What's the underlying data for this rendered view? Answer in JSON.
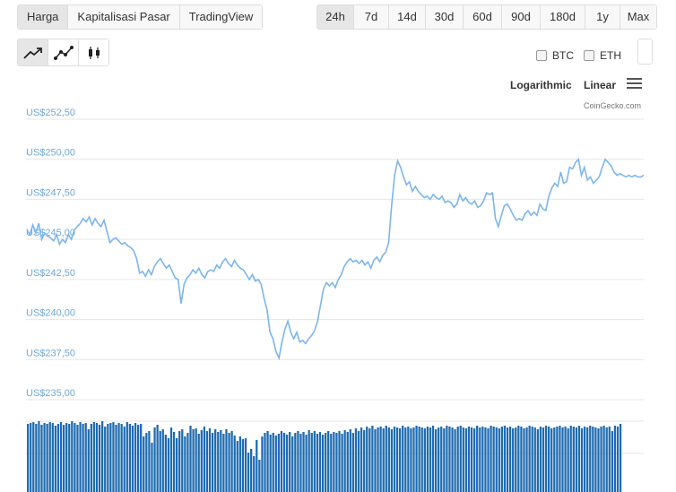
{
  "view_tabs": [
    {
      "label": "Harga",
      "active": true
    },
    {
      "label": "Kapitalisasi Pasar",
      "active": false
    },
    {
      "label": "TradingView",
      "active": false
    }
  ],
  "range_tabs": [
    {
      "label": "24h",
      "active": true
    },
    {
      "label": "7d",
      "active": false
    },
    {
      "label": "14d",
      "active": false
    },
    {
      "label": "30d",
      "active": false
    },
    {
      "label": "60d",
      "active": false
    },
    {
      "label": "90d",
      "active": false
    },
    {
      "label": "180d",
      "active": false
    },
    {
      "label": "1y",
      "active": false
    },
    {
      "label": "Max",
      "active": false
    }
  ],
  "chart_types": [
    {
      "icon": "line-chart-icon",
      "active": true
    },
    {
      "icon": "line-with-markers-icon",
      "active": false
    },
    {
      "icon": "candlestick-icon",
      "active": false
    }
  ],
  "compare": {
    "btc": {
      "label": "BTC",
      "checked": false
    },
    "eth": {
      "label": "ETH",
      "checked": false
    }
  },
  "scale_options": {
    "log": "Logarithmic",
    "linear": "Linear"
  },
  "credits": "CoinGecko.com",
  "colors": {
    "line": "#7cb5ec",
    "volume": "#1e6bb0",
    "grid": "#e6e6e6",
    "axis_label": "#6fa8d8"
  },
  "chart_data": {
    "type": "line",
    "ylim": [
      235.0,
      252.5
    ],
    "yticks": [
      252.5,
      250.0,
      247.5,
      245.0,
      242.5,
      240.0,
      237.5,
      235.0
    ],
    "ytick_labels": [
      "US$252,50",
      "US$250,00",
      "US$247,50",
      "US$245,00",
      "US$242,50",
      "US$240,00",
      "US$237,50",
      "US$235,00"
    ],
    "grid": true,
    "series": [
      {
        "values": [
          245.6,
          245.3,
          245.9,
          245.4,
          246.0,
          245.0,
          245.4,
          245.2,
          245.1,
          244.9,
          245.3,
          244.7,
          245.0,
          244.8,
          245.3,
          245.0,
          245.6,
          245.8,
          246.0,
          246.3,
          246.1,
          246.4,
          245.9,
          246.3,
          246.0,
          245.8,
          246.2,
          245.5,
          244.8,
          245.0,
          245.1,
          244.9,
          244.7,
          244.8,
          244.6,
          244.5,
          244.3,
          243.8,
          242.9,
          243.0,
          242.7,
          243.1,
          242.8,
          243.3,
          243.6,
          243.8,
          243.5,
          243.2,
          243.4,
          243.0,
          242.6,
          242.5,
          241.0,
          242.2,
          242.6,
          242.8,
          243.1,
          242.9,
          243.2,
          242.8,
          242.6,
          243.0,
          243.1,
          243.0,
          243.4,
          243.2,
          243.6,
          243.8,
          243.5,
          243.3,
          243.7,
          243.4,
          243.2,
          243.1,
          242.8,
          242.5,
          242.8,
          242.4,
          242.5,
          242.2,
          241.3,
          240.6,
          239.2,
          238.8,
          238.0,
          237.6,
          238.6,
          239.4,
          239.9,
          239.2,
          238.8,
          239.2,
          238.6,
          238.7,
          238.5,
          238.8,
          239.0,
          239.3,
          239.9,
          240.9,
          241.9,
          242.3,
          242.1,
          242.3,
          242.0,
          242.5,
          242.8,
          243.3,
          243.6,
          243.8,
          243.6,
          243.7,
          243.5,
          243.7,
          243.4,
          243.6,
          243.2,
          243.7,
          243.9,
          243.6,
          244.0,
          244.2,
          244.8,
          247.1,
          249.0,
          249.9,
          249.5,
          248.9,
          248.4,
          248.6,
          248.0,
          248.3,
          248.0,
          247.8,
          247.6,
          247.7,
          247.5,
          247.8,
          247.6,
          247.5,
          247.7,
          247.3,
          247.4,
          247.3,
          247.0,
          247.2,
          247.8,
          247.4,
          247.6,
          247.3,
          247.2,
          247.4,
          247.0,
          247.1,
          247.4,
          247.9,
          247.8,
          247.9,
          246.3,
          245.8,
          246.5,
          247.1,
          247.2,
          246.9,
          246.5,
          246.2,
          246.3,
          246.2,
          246.6,
          246.8,
          246.5,
          246.7,
          246.5,
          247.2,
          246.9,
          246.8,
          247.7,
          248.2,
          248.5,
          248.3,
          249.2,
          248.5,
          248.6,
          249.5,
          249.4,
          249.8,
          250.0,
          249.0,
          249.5,
          248.7,
          248.9,
          248.5,
          248.7,
          248.9,
          249.5,
          250.0,
          249.8,
          249.6,
          249.2,
          249.0,
          249.1,
          249.0,
          248.9,
          249.0,
          248.9,
          249.0,
          248.9,
          248.9,
          249.0
        ]
      }
    ],
    "volume": [
      76,
      77,
      78,
      76,
      79,
      75,
      77,
      76,
      78,
      77,
      74,
      76,
      78,
      75,
      77,
      76,
      79,
      77,
      75,
      78,
      76,
      77,
      70,
      76,
      78,
      77,
      75,
      79,
      73,
      76,
      77,
      78,
      75,
      77,
      76,
      73,
      78,
      76,
      74,
      77,
      75,
      76,
      62,
      66,
      68,
      55,
      72,
      75,
      68,
      70,
      64,
      60,
      72,
      67,
      60,
      68,
      70,
      62,
      66,
      74,
      70,
      71,
      65,
      69,
      73,
      68,
      71,
      66,
      70,
      67,
      69,
      65,
      70,
      66,
      68,
      63,
      57,
      62,
      59,
      60,
      44,
      48,
      40,
      58,
      36,
      62,
      66,
      68,
      64,
      66,
      63,
      65,
      68,
      66,
      64,
      67,
      62,
      66,
      68,
      65,
      67,
      64,
      69,
      66,
      68,
      65,
      67,
      64,
      66,
      68,
      65,
      67,
      66,
      68,
      65,
      69,
      67,
      70,
      66,
      71,
      68,
      72,
      69,
      73,
      71,
      74,
      70,
      72,
      73,
      71,
      74,
      72,
      70,
      73,
      72,
      71,
      74,
      72,
      73,
      71,
      72,
      74,
      73,
      72,
      71,
      73,
      72,
      74,
      70,
      72,
      73,
      71,
      74,
      73,
      72,
      70,
      73,
      74,
      72,
      71,
      73,
      72,
      71,
      74,
      72,
      73,
      72,
      71,
      74,
      73,
      72,
      71,
      73,
      74,
      72,
      73,
      71,
      72,
      74,
      73,
      71,
      72,
      74,
      73,
      72,
      70,
      73,
      72,
      74,
      73,
      71,
      72,
      73,
      74,
      72,
      73,
      71,
      74,
      73,
      72,
      74,
      71,
      73,
      72,
      74,
      73,
      72,
      71,
      73,
      74,
      72,
      73,
      68,
      74,
      73,
      76
    ]
  }
}
